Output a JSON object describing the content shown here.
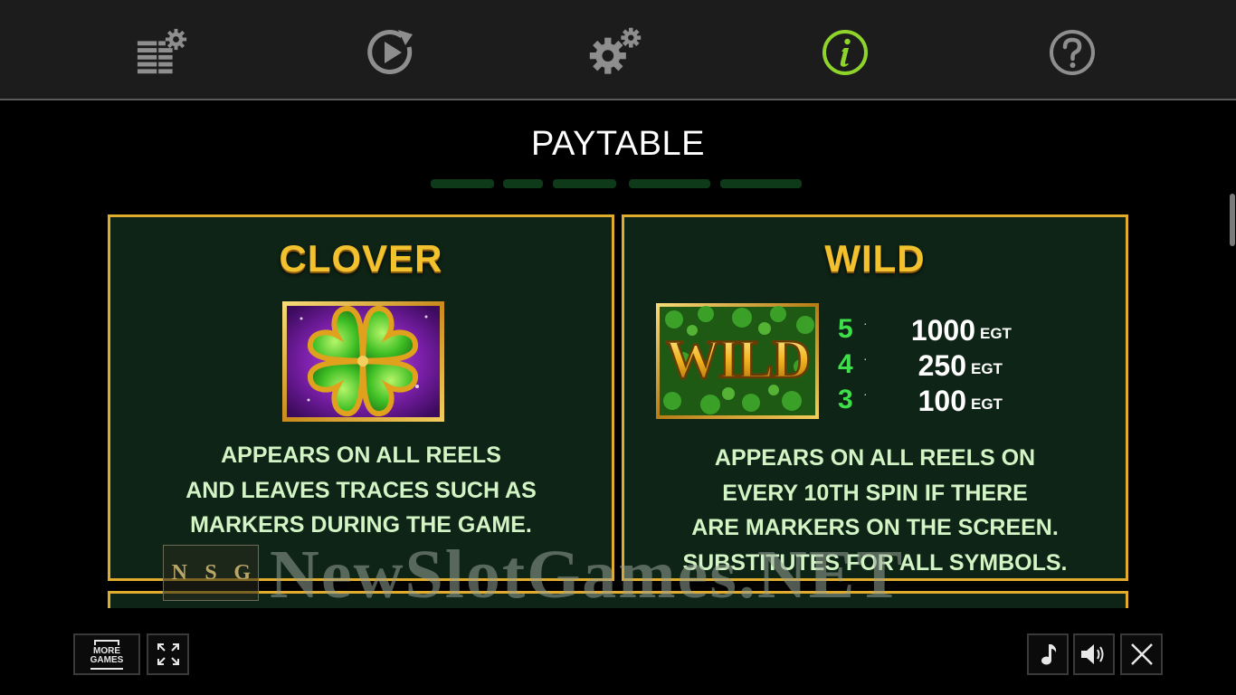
{
  "nav": {
    "items": [
      {
        "name": "bet-settings",
        "icon": "bet-settings-icon"
      },
      {
        "name": "autoplay",
        "icon": "autoplay-icon"
      },
      {
        "name": "settings",
        "icon": "settings-gears-icon"
      },
      {
        "name": "info",
        "icon": "info-icon",
        "active": true
      },
      {
        "name": "help",
        "icon": "help-icon"
      }
    ]
  },
  "page": {
    "title": "PAYTABLE"
  },
  "symbols": {
    "clover": {
      "title": "CLOVER",
      "icon": "clover-symbol-icon",
      "description_lines": [
        "APPEARS ON ALL REELS",
        "AND LEAVES TRACES SUCH AS",
        "MARKERS DURING THE GAME."
      ]
    },
    "wild": {
      "title": "WILD",
      "icon": "wild-symbol-icon",
      "image_text": "WILD",
      "payouts": [
        {
          "count": "5",
          "amount": "1000",
          "unit": "EGT"
        },
        {
          "count": "4",
          "amount": "250",
          "unit": "EGT"
        },
        {
          "count": "3",
          "amount": "100",
          "unit": "EGT"
        }
      ],
      "description_lines": [
        "APPEARS ON ALL REELS ON",
        "EVERY 10TH SPIN IF THERE",
        "ARE MARKERS ON THE SCREEN.",
        "SUBSTITUTES FOR ALL SYMBOLS."
      ]
    }
  },
  "watermark": {
    "logo_letters": [
      "N",
      "S",
      "G"
    ],
    "text": "NewSlotGames.NET"
  },
  "bottom": {
    "more_games_line1": "MORE",
    "more_games_line2": "GAMES",
    "fullscreen_icon": "fullscreen-icon",
    "music_icon": "music-note-icon",
    "sound_icon": "speaker-icon",
    "close_icon": "close-icon"
  },
  "colors": {
    "accent_gold": "#e1ac2d",
    "active_green": "#8ed42a",
    "panel_bg": "#0e2416",
    "count_green": "#3ee04a"
  }
}
